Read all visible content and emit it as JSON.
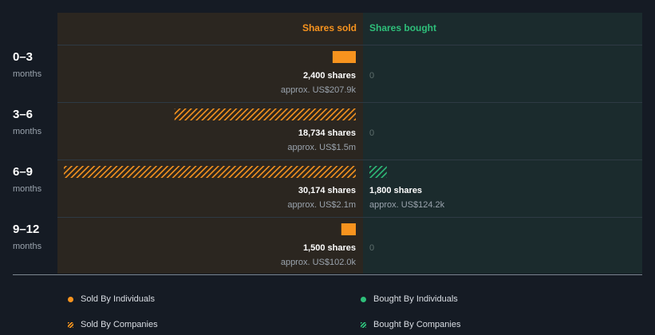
{
  "colors": {
    "background": "#151b24",
    "sold_panel": "#2b2620",
    "bought_panel": "#1b2b2d",
    "sold": "#f7931e",
    "bought": "#2ebf7a",
    "divider": "#2e3a44",
    "label": "#ffffff",
    "sublabel": "#9aa3ad",
    "zero": "#5e6e6c"
  },
  "headers": {
    "sold": "Shares sold",
    "bought": "Shares bought"
  },
  "chart_data": {
    "type": "bar",
    "categories": [
      "0–3",
      "3–6",
      "6–9",
      "9–12"
    ],
    "category_unit": "months",
    "series": [
      {
        "name": "Shares sold",
        "individuals": [
          2400,
          0,
          0,
          1500
        ],
        "companies": [
          0,
          18734,
          30174,
          0
        ],
        "shares_labels": [
          "2,400 shares",
          "18,734 shares",
          "30,174 shares",
          "1,500 shares"
        ],
        "value_labels": [
          "approx. US$207.9k",
          "approx. US$1.5m",
          "approx. US$2.1m",
          "approx. US$102.0k"
        ]
      },
      {
        "name": "Shares bought",
        "individuals": [
          0,
          0,
          0,
          0
        ],
        "companies": [
          0,
          0,
          1800,
          0
        ],
        "shares_labels": [
          "0",
          "0",
          "1,800 shares",
          "0"
        ],
        "value_labels": [
          "",
          "",
          "approx. US$124.2k",
          ""
        ]
      }
    ],
    "legend": [
      {
        "label": "Sold By Individuals",
        "kind": "sold",
        "style": "solid"
      },
      {
        "label": "Bought By Individuals",
        "kind": "bought",
        "style": "solid"
      },
      {
        "label": "Sold By Companies",
        "kind": "sold",
        "style": "hatched"
      },
      {
        "label": "Bought By Companies",
        "kind": "bought",
        "style": "hatched"
      }
    ],
    "legend_position": "bottom"
  }
}
